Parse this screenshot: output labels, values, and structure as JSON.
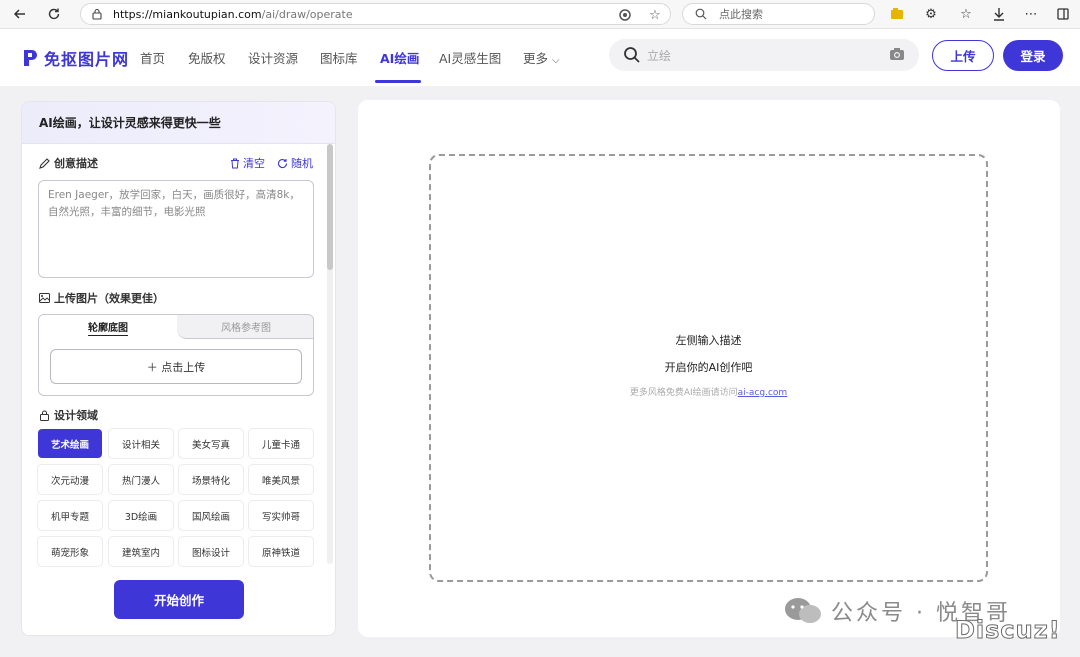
{
  "browser": {
    "url_host": "https://miankoutupian.com",
    "url_path": "/ai/draw/operate",
    "search_placeholder": "点此搜索"
  },
  "header": {
    "logo_text": "免抠图片网",
    "nav": [
      "首页",
      "免版权",
      "设计资源",
      "图标库",
      "AI绘画",
      "AI灵感生图",
      "更多"
    ],
    "active_nav": "AI绘画",
    "search_placeholder": "立绘",
    "upload_label": "上传",
    "login_label": "登录"
  },
  "left_panel": {
    "title": "AI绘画，让设计灵感来得更快一些",
    "prompt_section": {
      "title": "创意描述",
      "clear_label": "清空",
      "random_label": "随机",
      "prompt_text": "Eren Jaeger，放学回家，白天，画质很好，高清8k，自然光照，丰富的细节，电影光照"
    },
    "upload_section": {
      "title": "上传图片（效果更佳）",
      "tab_outline": "轮廓底图",
      "tab_style": "风格参考图",
      "click_upload": "＋ 点击上传"
    },
    "domain_section": {
      "title": "设计领域",
      "chips": [
        "艺术绘画",
        "设计相关",
        "美女写真",
        "儿童卡通",
        "次元动漫",
        "热门漫人",
        "场景特化",
        "唯美风景",
        "机甲专题",
        "3D绘画",
        "国风绘画",
        "写实帅哥",
        "萌宠形象",
        "建筑室内",
        "图标设计",
        "原神铁道"
      ],
      "active_chip": "艺术绘画"
    },
    "start_label": "开始创作"
  },
  "canvas": {
    "hint_line1": "左侧输入描述",
    "hint_line2": "开启你的AI创作吧",
    "hint_line3_prefix": "更多风格免费AI绘画请访问",
    "hint_link": "ai-acg.com"
  },
  "watermark": {
    "wechat_text": "公众号 · 悦智哥",
    "discuz_text": "Discuz!"
  },
  "colors": {
    "brand": "#3e36d6",
    "panel_bg": "#f1f1f4"
  }
}
